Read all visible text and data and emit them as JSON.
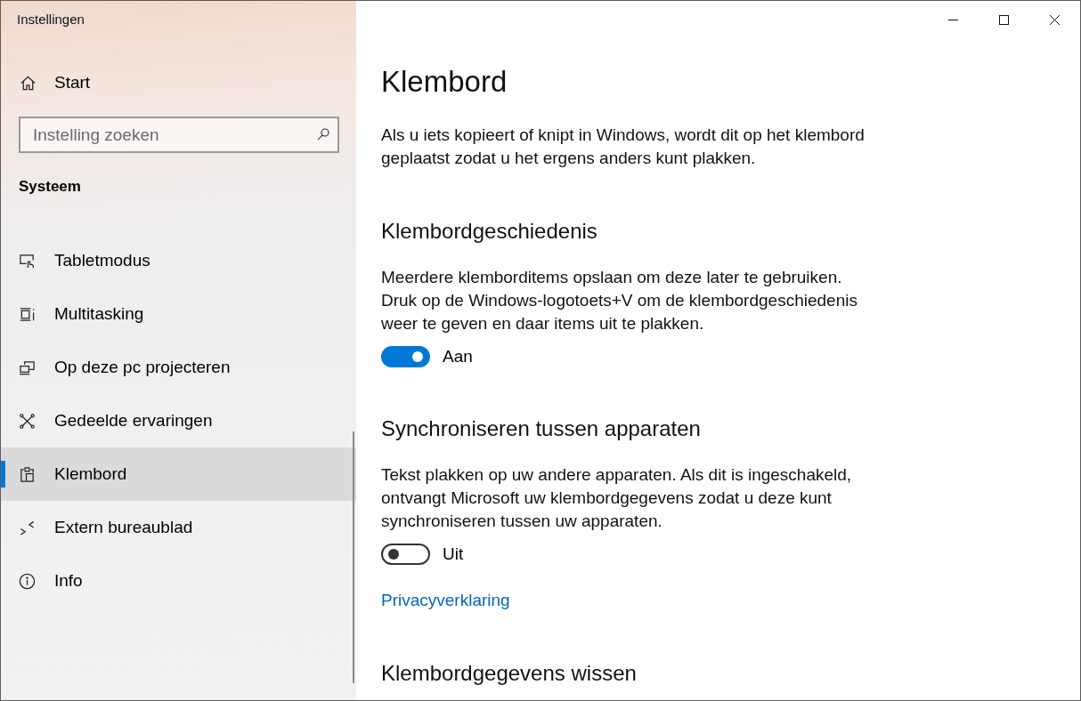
{
  "window": {
    "title": "Instellingen"
  },
  "sidebar": {
    "home": {
      "label": "Start"
    },
    "search": {
      "placeholder": "Instelling zoeken"
    },
    "section": "Systeem",
    "items": [
      {
        "kind": "tablet",
        "label": "Tabletmodus",
        "selected": false
      },
      {
        "kind": "multitasking",
        "label": "Multitasking",
        "selected": false
      },
      {
        "kind": "project",
        "label": "Op deze pc projecteren",
        "selected": false
      },
      {
        "kind": "shared",
        "label": "Gedeelde ervaringen",
        "selected": false
      },
      {
        "kind": "clipboard",
        "label": "Klembord",
        "selected": true
      },
      {
        "kind": "remote",
        "label": "Extern bureaublad",
        "selected": false
      },
      {
        "kind": "info",
        "label": "Info",
        "selected": false
      }
    ]
  },
  "page": {
    "title": "Klembord",
    "intro": "Als u iets kopieert of knipt in Windows, wordt dit op het klembord geplaatst zodat u het ergens anders kunt plakken.",
    "sections": [
      {
        "heading": "Klembordgeschiedenis",
        "text": "Meerdere klemborditems opslaan om deze later te gebruiken. Druk op de Windows-logotoets+V om de klembordgeschiedenis weer te geven en daar items uit te plakken.",
        "toggle": {
          "on": true,
          "label": "Aan"
        }
      },
      {
        "heading": "Synchroniseren tussen apparaten",
        "text": "Tekst plakken op uw andere apparaten. Als dit is ingeschakeld, ontvangt Microsoft uw klembordgegevens zodat u deze kunt synchroniseren tussen uw apparaten.",
        "toggle": {
          "on": false,
          "label": "Uit"
        },
        "link": "Privacyverklaring"
      },
      {
        "heading": "Klembordgegevens wissen"
      }
    ]
  }
}
